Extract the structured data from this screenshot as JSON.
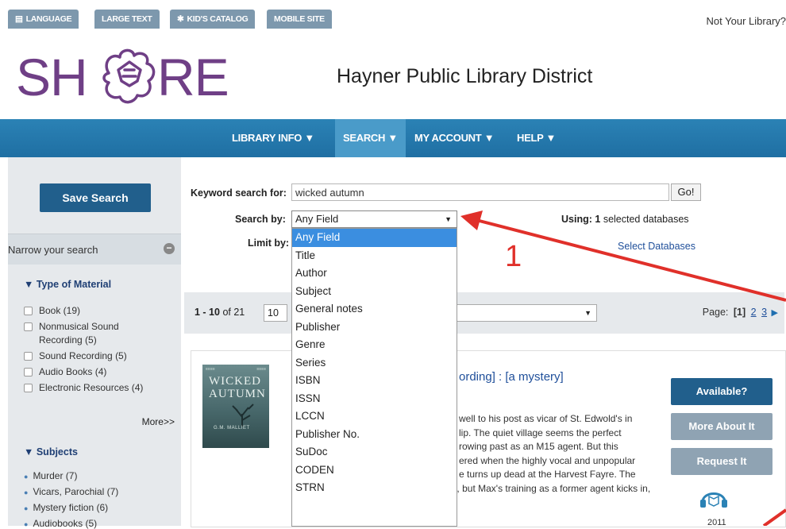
{
  "top_links": [
    {
      "label": "LANGUAGE",
      "icon": "flag-icon"
    },
    {
      "label": "LARGE TEXT",
      "icon": ""
    },
    {
      "label": "KID'S CATALOG",
      "icon": "star-icon"
    },
    {
      "label": "MOBILE SITE",
      "icon": ""
    }
  ],
  "not_your_library": "Not Your Library?",
  "logo": {
    "left": "SH",
    "right": "RE"
  },
  "library_name": "Hayner Public Library District",
  "nav": [
    {
      "label": "LIBRARY INFO ▼",
      "active": false
    },
    {
      "label": "SEARCH ▼",
      "active": true
    },
    {
      "label": "MY ACCOUNT ▼",
      "active": false
    },
    {
      "label": "HELP ▼",
      "active": false
    }
  ],
  "sidebar": {
    "save_search": "Save Search",
    "narrow_title": "Narrow your search",
    "type_heading": "▼ Type of Material",
    "materials": [
      {
        "label": "Book (19)"
      },
      {
        "label": "Nonmusical Sound",
        "label2": "Recording (5)"
      },
      {
        "label": "Sound Recording (5)"
      },
      {
        "label": "Audio Books (4)"
      },
      {
        "label": "Electronic Resources (4)"
      }
    ],
    "more": "More>>",
    "subjects_heading": "▼ Subjects",
    "subjects": [
      "Murder (7)",
      "Vicars, Parochial (7)",
      "Mystery fiction (6)",
      "Audiobooks (5)"
    ]
  },
  "search": {
    "keyword_label": "Keyword search for:",
    "keyword_value": "wicked autumn",
    "go": "Go!",
    "search_by_label": "Search by:",
    "search_by_value": "Any Field",
    "limit_by_label": "Limit by:",
    "using_label": "Using:",
    "using_count": "1",
    "using_suffix": "selected databases",
    "select_databases": "Select Databases",
    "options": [
      "Any Field",
      "Title",
      "Author",
      "Subject",
      "General notes",
      "Publisher",
      "Genre",
      "Series",
      "ISBN",
      "ISSN",
      "LCCN",
      "Publisher No.",
      "SuDoc",
      "CODEN",
      "STRN"
    ],
    "selected_option": "Any Field"
  },
  "results": {
    "range": "1 - 10",
    "of_text": "of 21",
    "per_page": "10",
    "page_label": "Page:",
    "current_page": "[1]",
    "pages": [
      "2",
      "3"
    ]
  },
  "record": {
    "cover_title_1": "WICKED",
    "cover_title_2": "AUTUMN",
    "cover_author": "G.M. MALLIET",
    "title": "ording] : [a mystery]",
    "description": [
      "well to his post as vicar of St. Edwold's in",
      "lip. The quiet village seems the perfect",
      "rowing past as an M15 agent. But this",
      "ered when the highly vocal and unpopular",
      "e turns up dead at the Harvest Fayre. The",
      "death looks like an accident, but Max's training as a former agent kicks in,"
    ],
    "buttons": [
      "Available?",
      "More About It",
      "Request It"
    ],
    "year": "2011"
  },
  "annotation_number": "1",
  "colors": {
    "nav_blue": "#2b82b5",
    "dark_blue_button": "#215f8c",
    "gray_button": "#8fa3b3",
    "logo_purple": "#6f3f86",
    "annotation_red": "#e0302a",
    "dropdown_highlight": "#3b8ee0"
  }
}
